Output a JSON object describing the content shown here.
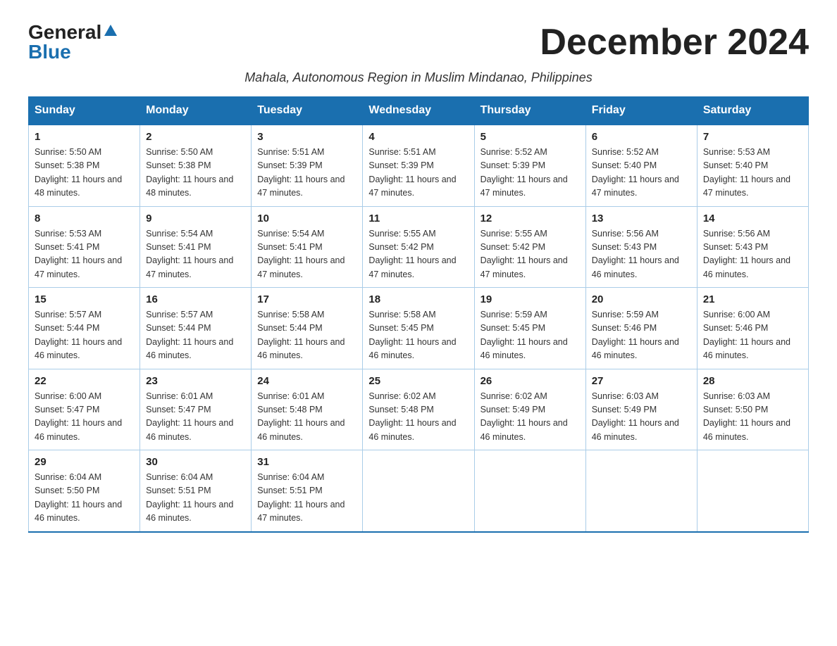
{
  "header": {
    "logo_general": "General",
    "logo_blue": "Blue",
    "month_title": "December 2024",
    "subtitle": "Mahala, Autonomous Region in Muslim Mindanao, Philippines"
  },
  "days_of_week": [
    "Sunday",
    "Monday",
    "Tuesday",
    "Wednesday",
    "Thursday",
    "Friday",
    "Saturday"
  ],
  "weeks": [
    [
      {
        "day": "1",
        "sunrise": "5:50 AM",
        "sunset": "5:38 PM",
        "daylight": "11 hours and 48 minutes."
      },
      {
        "day": "2",
        "sunrise": "5:50 AM",
        "sunset": "5:38 PM",
        "daylight": "11 hours and 48 minutes."
      },
      {
        "day": "3",
        "sunrise": "5:51 AM",
        "sunset": "5:39 PM",
        "daylight": "11 hours and 47 minutes."
      },
      {
        "day": "4",
        "sunrise": "5:51 AM",
        "sunset": "5:39 PM",
        "daylight": "11 hours and 47 minutes."
      },
      {
        "day": "5",
        "sunrise": "5:52 AM",
        "sunset": "5:39 PM",
        "daylight": "11 hours and 47 minutes."
      },
      {
        "day": "6",
        "sunrise": "5:52 AM",
        "sunset": "5:40 PM",
        "daylight": "11 hours and 47 minutes."
      },
      {
        "day": "7",
        "sunrise": "5:53 AM",
        "sunset": "5:40 PM",
        "daylight": "11 hours and 47 minutes."
      }
    ],
    [
      {
        "day": "8",
        "sunrise": "5:53 AM",
        "sunset": "5:41 PM",
        "daylight": "11 hours and 47 minutes."
      },
      {
        "day": "9",
        "sunrise": "5:54 AM",
        "sunset": "5:41 PM",
        "daylight": "11 hours and 47 minutes."
      },
      {
        "day": "10",
        "sunrise": "5:54 AM",
        "sunset": "5:41 PM",
        "daylight": "11 hours and 47 minutes."
      },
      {
        "day": "11",
        "sunrise": "5:55 AM",
        "sunset": "5:42 PM",
        "daylight": "11 hours and 47 minutes."
      },
      {
        "day": "12",
        "sunrise": "5:55 AM",
        "sunset": "5:42 PM",
        "daylight": "11 hours and 47 minutes."
      },
      {
        "day": "13",
        "sunrise": "5:56 AM",
        "sunset": "5:43 PM",
        "daylight": "11 hours and 46 minutes."
      },
      {
        "day": "14",
        "sunrise": "5:56 AM",
        "sunset": "5:43 PM",
        "daylight": "11 hours and 46 minutes."
      }
    ],
    [
      {
        "day": "15",
        "sunrise": "5:57 AM",
        "sunset": "5:44 PM",
        "daylight": "11 hours and 46 minutes."
      },
      {
        "day": "16",
        "sunrise": "5:57 AM",
        "sunset": "5:44 PM",
        "daylight": "11 hours and 46 minutes."
      },
      {
        "day": "17",
        "sunrise": "5:58 AM",
        "sunset": "5:44 PM",
        "daylight": "11 hours and 46 minutes."
      },
      {
        "day": "18",
        "sunrise": "5:58 AM",
        "sunset": "5:45 PM",
        "daylight": "11 hours and 46 minutes."
      },
      {
        "day": "19",
        "sunrise": "5:59 AM",
        "sunset": "5:45 PM",
        "daylight": "11 hours and 46 minutes."
      },
      {
        "day": "20",
        "sunrise": "5:59 AM",
        "sunset": "5:46 PM",
        "daylight": "11 hours and 46 minutes."
      },
      {
        "day": "21",
        "sunrise": "6:00 AM",
        "sunset": "5:46 PM",
        "daylight": "11 hours and 46 minutes."
      }
    ],
    [
      {
        "day": "22",
        "sunrise": "6:00 AM",
        "sunset": "5:47 PM",
        "daylight": "11 hours and 46 minutes."
      },
      {
        "day": "23",
        "sunrise": "6:01 AM",
        "sunset": "5:47 PM",
        "daylight": "11 hours and 46 minutes."
      },
      {
        "day": "24",
        "sunrise": "6:01 AM",
        "sunset": "5:48 PM",
        "daylight": "11 hours and 46 minutes."
      },
      {
        "day": "25",
        "sunrise": "6:02 AM",
        "sunset": "5:48 PM",
        "daylight": "11 hours and 46 minutes."
      },
      {
        "day": "26",
        "sunrise": "6:02 AM",
        "sunset": "5:49 PM",
        "daylight": "11 hours and 46 minutes."
      },
      {
        "day": "27",
        "sunrise": "6:03 AM",
        "sunset": "5:49 PM",
        "daylight": "11 hours and 46 minutes."
      },
      {
        "day": "28",
        "sunrise": "6:03 AM",
        "sunset": "5:50 PM",
        "daylight": "11 hours and 46 minutes."
      }
    ],
    [
      {
        "day": "29",
        "sunrise": "6:04 AM",
        "sunset": "5:50 PM",
        "daylight": "11 hours and 46 minutes."
      },
      {
        "day": "30",
        "sunrise": "6:04 AM",
        "sunset": "5:51 PM",
        "daylight": "11 hours and 46 minutes."
      },
      {
        "day": "31",
        "sunrise": "6:04 AM",
        "sunset": "5:51 PM",
        "daylight": "11 hours and 47 minutes."
      },
      null,
      null,
      null,
      null
    ]
  ]
}
